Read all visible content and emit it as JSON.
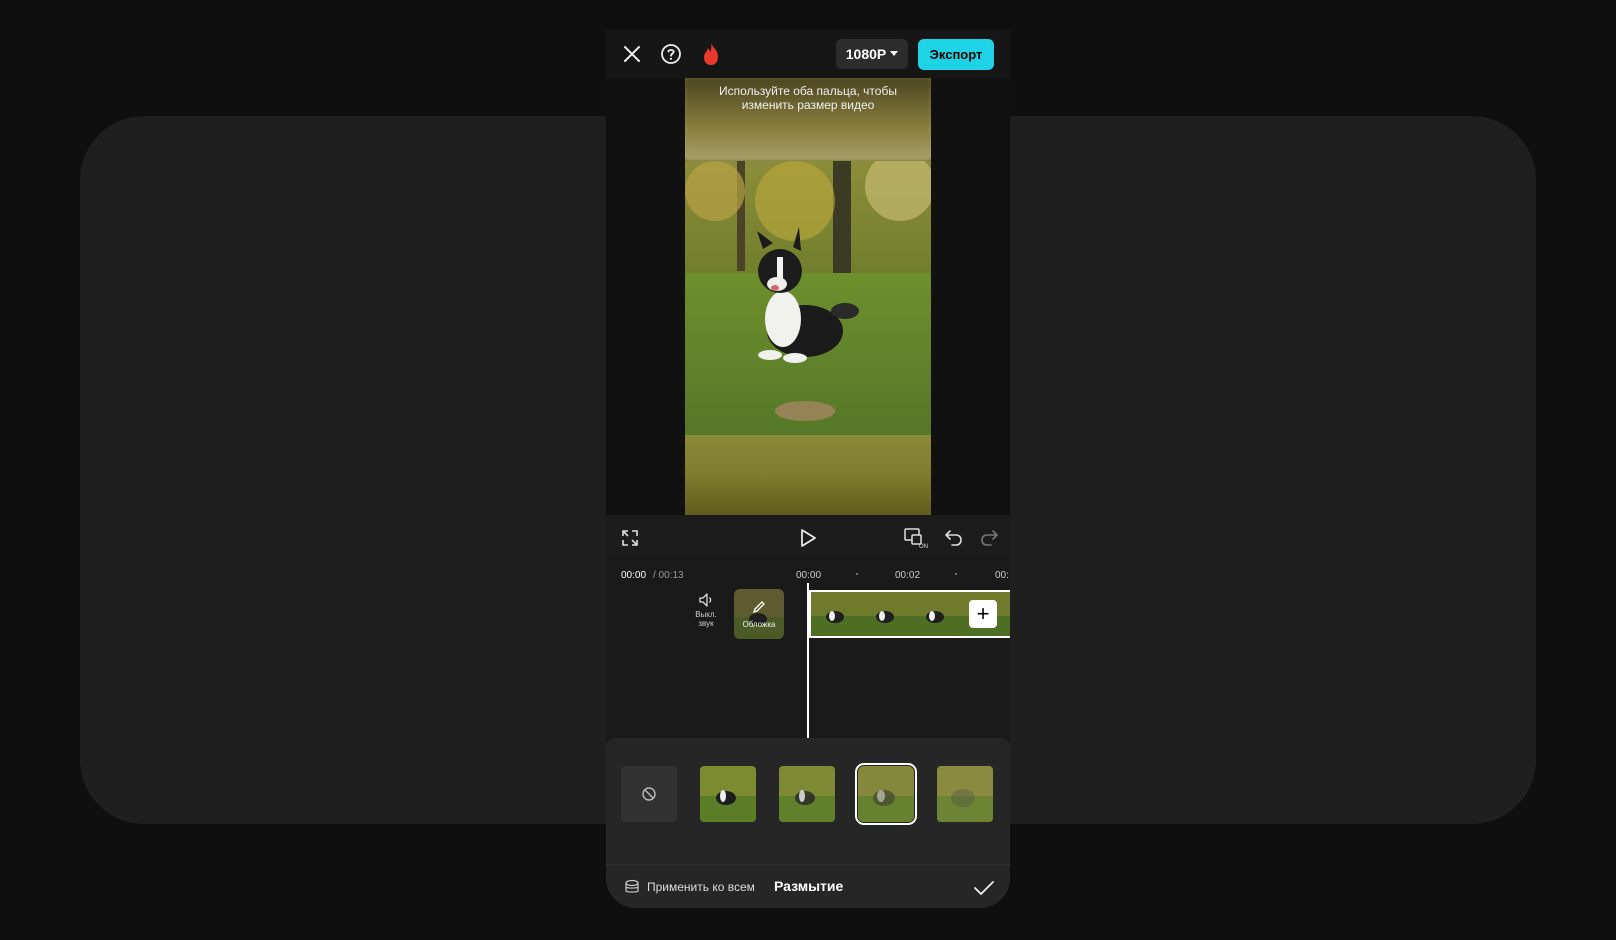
{
  "topbar": {
    "close_icon": "close-icon",
    "help_icon": "help-icon",
    "premium_icon": "flame-icon",
    "resolution": "1080P",
    "export_label": "Экспорт"
  },
  "preview": {
    "hint_line1": "Используйте оба пальца, чтобы",
    "hint_line2": "изменить размер видео"
  },
  "controls": {
    "fullscreen_icon": "fullscreen-icon",
    "play_icon": "play-icon",
    "keyframe_icon": "pip-on-icon",
    "undo_icon": "undo-icon",
    "redo_icon": "redo-icon"
  },
  "ruler": {
    "current_time": "00:00",
    "total_time": "/ 00:13",
    "tick_0": "00:00",
    "tick_1": "00:02",
    "tick_2": "00:"
  },
  "timeline": {
    "mute_line1": "Выкл.",
    "mute_line2": "звук",
    "cover_label": "Обложка",
    "add_label": "+"
  },
  "panel": {
    "apply_all": "Применить ко всем",
    "title": "Размытие",
    "selected_index": 3
  },
  "colors": {
    "accent": "#1fd3e6",
    "background": "#0f0f0f",
    "panel": "#262626"
  }
}
